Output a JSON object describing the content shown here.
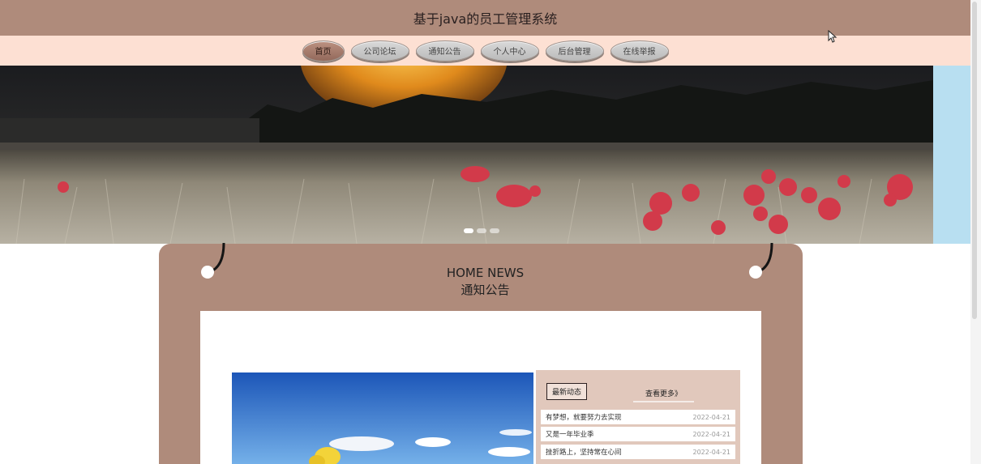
{
  "header": {
    "title": "基于java的员工管理系统"
  },
  "nav": {
    "items": [
      {
        "label": "首页"
      },
      {
        "label": "公司论坛"
      },
      {
        "label": "通知公告"
      },
      {
        "label": "个人中心"
      },
      {
        "label": "后台管理"
      },
      {
        "label": "在线举报"
      }
    ]
  },
  "banner": {
    "slide_count": 3,
    "active_slide": 1
  },
  "news": {
    "heading_en": "HOME NEWS",
    "heading_cn": "通知公告",
    "latest_tab": "最新动态",
    "more_link": "查看更多》",
    "items": [
      {
        "title": "有梦想，就要努力去实现",
        "date": "2022-04-21"
      },
      {
        "title": "又是一年毕业季",
        "date": "2022-04-21"
      },
      {
        "title": "挫折路上，坚持常在心间",
        "date": "2022-04-21"
      }
    ]
  },
  "colors": {
    "header_bg": "#af8b7b",
    "nav_bg": "#fde0d3",
    "panel_bg": "#af8b7b"
  }
}
